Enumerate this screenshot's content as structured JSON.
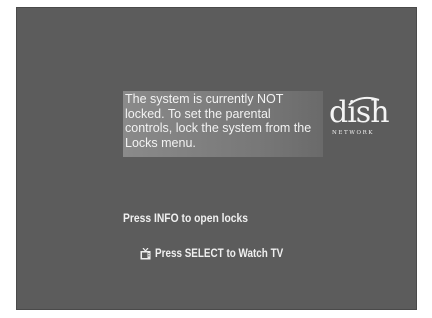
{
  "message": {
    "text": "The system is currently NOT locked. To set the parental controls, lock the system from the Locks menu."
  },
  "logo": {
    "word": "dish",
    "subtitle": "NETWORK"
  },
  "hints": {
    "info": "Press INFO to open locks",
    "select": "Press SELECT to Watch TV"
  },
  "icons": {
    "select": "tv-icon"
  },
  "colors": {
    "screen_background": "#5c5c5c",
    "text": "#f0f0f0"
  }
}
